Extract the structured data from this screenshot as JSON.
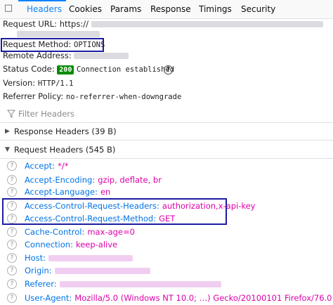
{
  "tabs": {
    "close_glyph": "□",
    "items": [
      "Headers",
      "Cookies",
      "Params",
      "Response",
      "Timings",
      "Security"
    ],
    "selected": "Headers"
  },
  "summary": {
    "request_url_label": "Request URL:",
    "request_url_value": "https://",
    "request_method_label": "Request Method:",
    "request_method_value": "OPTIONS",
    "remote_address_label": "Remote Address:",
    "status_code_label": "Status Code:",
    "status_code_value": "200",
    "status_text": "Connection established",
    "version_label": "Version:",
    "version_value": "HTTP/1.1",
    "referrer_policy_label": "Referrer Policy:",
    "referrer_policy_value": "no-referrer-when-downgrade"
  },
  "filter": {
    "placeholder": "Filter Headers"
  },
  "response_headers": {
    "label": "Response Headers (39 B)",
    "collapsed": true
  },
  "request_headers": {
    "label": "Request Headers (545 B)",
    "collapsed": false,
    "items": [
      {
        "key": "Accept:",
        "value": "*/*"
      },
      {
        "key": "Accept-Encoding:",
        "value": "gzip, deflate, br"
      },
      {
        "key": "Accept-Language:",
        "value": "en"
      },
      {
        "key": "Access-Control-Request-Headers:",
        "value": "authorization,x-api-key"
      },
      {
        "key": "Access-Control-Request-Method:",
        "value": "GET"
      },
      {
        "key": "Cache-Control:",
        "value": "max-age=0"
      },
      {
        "key": "Connection:",
        "value": "keep-alive"
      },
      {
        "key": "Host:",
        "value": ""
      },
      {
        "key": "Origin:",
        "value": ""
      },
      {
        "key": "Referer:",
        "value": ""
      },
      {
        "key": "User-Agent:",
        "value": "Mozilla/5.0 (Windows NT 10.0; …) Gecko/20100101 Firefox/76.0"
      }
    ]
  },
  "colors": {
    "accent": "#0a84ff",
    "key": "#0074e8",
    "value": "#dd00a9",
    "status_ok": "#058b00",
    "highlight_box": "#1c1ca0"
  }
}
